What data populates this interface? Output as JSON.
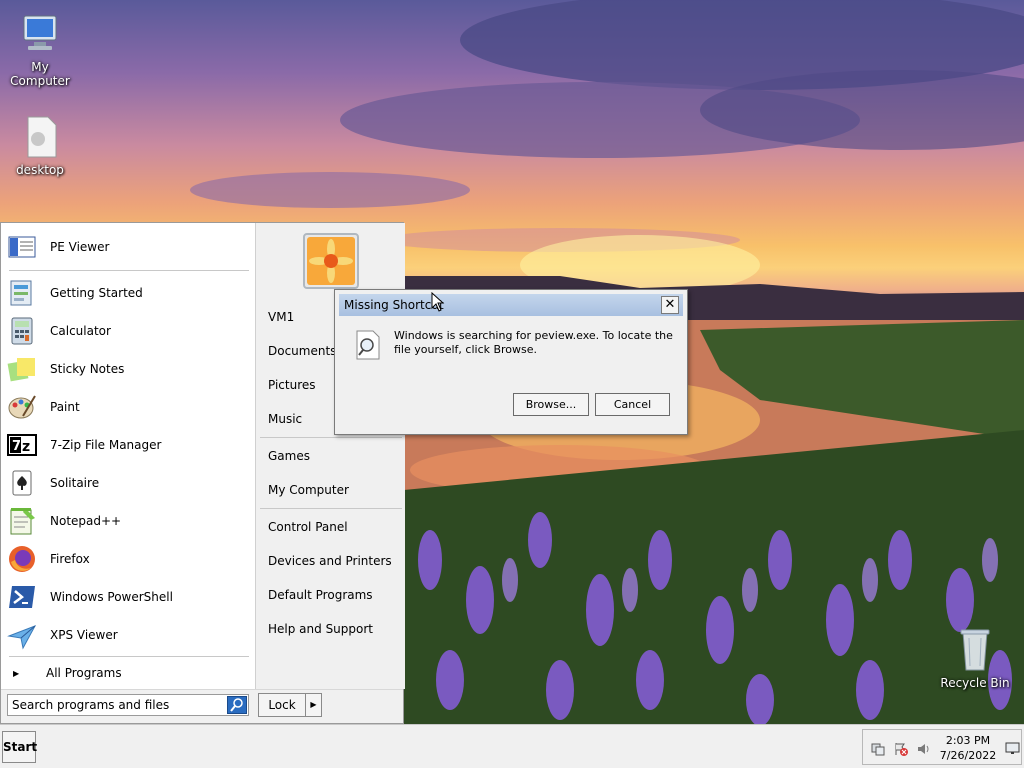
{
  "desktop": {
    "icons": [
      {
        "label": "My Computer",
        "icon": "my-computer-icon"
      },
      {
        "label": "desktop",
        "icon": "document-icon"
      },
      {
        "label": "Recycle Bin",
        "icon": "recycle-bin-icon"
      }
    ]
  },
  "start_menu": {
    "pinned": [
      {
        "label": "PE Viewer",
        "icon": "pe-viewer-icon"
      }
    ],
    "programs": [
      {
        "label": "Getting Started",
        "icon": "getting-started-icon"
      },
      {
        "label": "Calculator",
        "icon": "calculator-icon"
      },
      {
        "label": "Sticky Notes",
        "icon": "sticky-notes-icon"
      },
      {
        "label": "Paint",
        "icon": "paint-icon"
      },
      {
        "label": "7-Zip File Manager",
        "icon": "7zip-icon"
      },
      {
        "label": "Solitaire",
        "icon": "solitaire-icon"
      },
      {
        "label": "Notepad++",
        "icon": "notepadpp-icon"
      },
      {
        "label": "Firefox",
        "icon": "firefox-icon"
      },
      {
        "label": "Windows PowerShell",
        "icon": "powershell-icon"
      },
      {
        "label": "XPS Viewer",
        "icon": "xps-viewer-icon"
      }
    ],
    "all_programs": "All Programs",
    "search_placeholder": "Search programs and files",
    "right_links": [
      "VM1",
      "Documents",
      "Pictures",
      "Music",
      "Games",
      "My Computer",
      "Control Panel",
      "Devices and Printers",
      "Default Programs",
      "Help and Support"
    ],
    "lock_label": "Lock"
  },
  "dialog": {
    "title": "Missing Shortcut",
    "message": "Windows is searching for peview.exe. To locate the file yourself, click Browse.",
    "browse_label": "Browse...",
    "cancel_label": "Cancel",
    "close_glyph": "✕"
  },
  "taskbar": {
    "start_label": "Start",
    "time": "2:03 PM",
    "date": "7/26/2022"
  }
}
